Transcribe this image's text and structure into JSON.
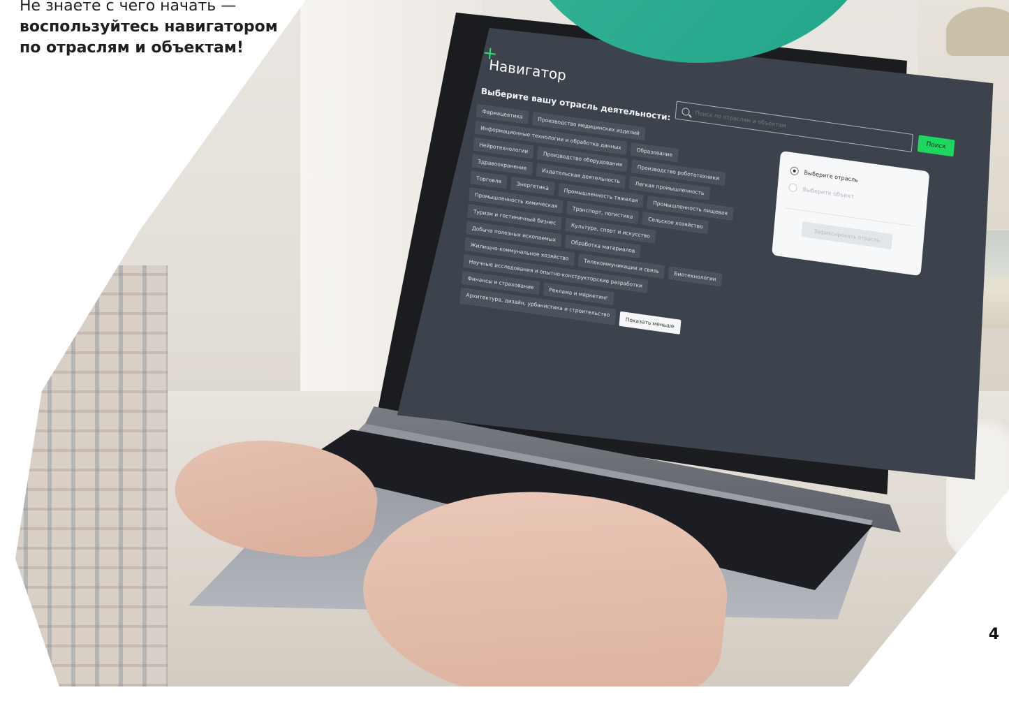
{
  "headline": {
    "line1": "Не знаете с чего начать —",
    "line2": "воспользуйтесь навигатором",
    "line3": "по отраслям и объектам!"
  },
  "page_number": "4",
  "app": {
    "title": "Навигатор",
    "search_placeholder": "Поиск по отраслям и объектам",
    "search_button": "Поиск",
    "subtitle": "Выберите вашу отрасль деятельности:",
    "industries": [
      "Фармацевтика",
      "Производство медицинских изделий",
      "Информационные технологии и обработка данных",
      "Образование",
      "Нейротехнологии",
      "Производство оборудования",
      "Производство робототехники",
      "Здравоохранение",
      "Издательская деятельность",
      "Легкая промышленность",
      "Торговля",
      "Энергетика",
      "Промышленность тяжелая",
      "Промышленность пищевая",
      "Промышленность химическая",
      "Транспорт, логистика",
      "Сельское хозяйство",
      "Туризм и гостиничный бизнес",
      "Культура, спорт и искусство",
      "Добыча полезных ископаемых",
      "Обработка материалов",
      "Жилищно-коммунальное хозяйство",
      "Телекоммуникации и связь",
      "Биотехнологии",
      "Научные исследования и опытно-конструкторские разработки",
      "Финансы и страхование",
      "Реклама и маркетинг",
      "Архитектура, дизайн, урбанистика и строительство"
    ],
    "show_less": "Показать меньше",
    "panel": {
      "option1": "Выберите отрасль",
      "option2": "Выберите объект",
      "confirm": "Зафиксировать отрасль"
    }
  },
  "colors": {
    "accent_green": "#1ed760",
    "teal": "#23a48a",
    "screen_bg": "#3d434c"
  }
}
